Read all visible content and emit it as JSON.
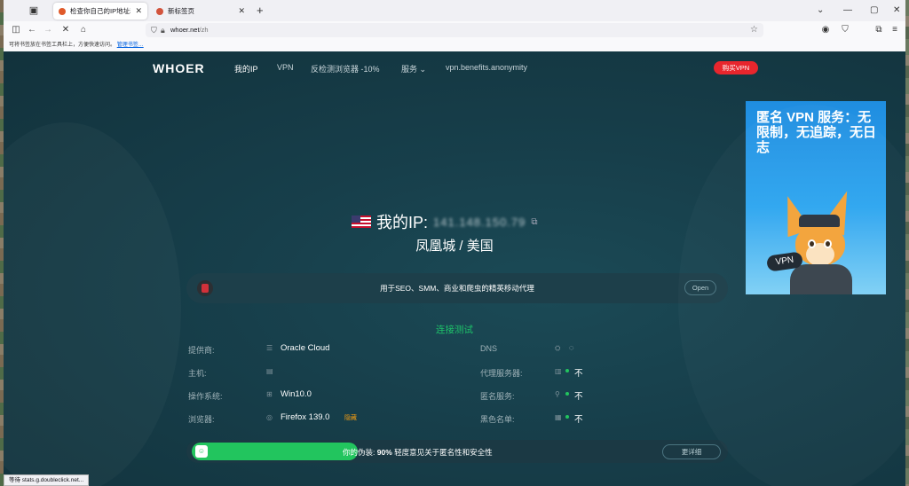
{
  "browser": {
    "tabs": [
      {
        "title": "检查你自己的IP地址和DNS地址",
        "active": true,
        "favicon_color": "#e05a2a"
      },
      {
        "title": "新标签页",
        "active": false,
        "favicon_color": "#d2533c"
      }
    ],
    "url_domain": "whoer.net",
    "url_path": "/zh",
    "bookmarks_message": "可将书签放在书签工具栏上，方便快速访问。",
    "bookmarks_link": "管理书签…",
    "status_text": "等待 stats.g.doubleclick.net..."
  },
  "nav": {
    "logo": "WHOER",
    "links": [
      "我的IP",
      "VPN",
      "反检测浏览器 -10%",
      "服务 ⌄",
      "vpn.benefits.anonymity"
    ],
    "buy_button": "购买VPN"
  },
  "ad": {
    "text": "匿名 VPN 服务：无限制，无追踪，无日志",
    "badge": "VPN"
  },
  "ip": {
    "label": "我的IP:",
    "value": "141.148.150.79",
    "location": "凤凰城 / 美国"
  },
  "promo": {
    "text": "用于SEO、SMM、商业和爬虫的精英移动代理",
    "button": "Open"
  },
  "section_title": "连接测试",
  "left_info": [
    {
      "label": "提供商:",
      "icon": "wifi-icon",
      "glyph": "☰",
      "value": "Oracle Cloud",
      "tag": ""
    },
    {
      "label": "主机:",
      "icon": "host-icon",
      "glyph": "▤",
      "value": "",
      "tag": ""
    },
    {
      "label": "操作系统:",
      "icon": "windows-icon",
      "glyph": "⊞",
      "value": "Win10.0",
      "tag": ""
    },
    {
      "label": "浏览器:",
      "icon": "browser-icon",
      "glyph": "◎",
      "value": "Firefox 139.0",
      "tag": "隐藏"
    }
  ],
  "right_info": [
    {
      "label": "DNS",
      "icon": "network-icon",
      "glyph": "⛭",
      "value": "◌",
      "status_dot": false
    },
    {
      "label": "代理服务器:",
      "icon": "server-icon",
      "glyph": "▥",
      "value": "不",
      "status_dot": true
    },
    {
      "label": "匿名服务:",
      "icon": "user-icon",
      "glyph": "⚲",
      "value": "不",
      "status_dot": true
    },
    {
      "label": "黑色名单:",
      "icon": "list-icon",
      "glyph": "▦",
      "value": "不",
      "status_dot": true
    }
  ],
  "disguise": {
    "percent": 90,
    "prefix": "你的伪装: ",
    "percent_text": "90%",
    "suffix": " 轻度意见关于匿名性和安全性",
    "button": "更详细",
    "accent": "#22c55e"
  }
}
